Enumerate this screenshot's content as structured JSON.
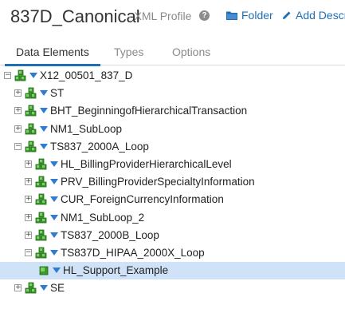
{
  "header": {
    "title": "837D_Canonical",
    "subtitle": "- XML Profile",
    "help_icon": "?",
    "folder_label": "Folder",
    "add_label": "Add Descri"
  },
  "tabs": [
    {
      "label": "Data Elements",
      "active": true
    },
    {
      "label": "Types",
      "active": false
    },
    {
      "label": "Options",
      "active": false
    }
  ],
  "tree": [
    {
      "label": "X12_00501_837_D",
      "depth": 0,
      "expander": "⊟",
      "icon": "multi-element-icon"
    },
    {
      "label": "ST",
      "depth": 1,
      "expander": "⊞",
      "icon": "multi-element-icon"
    },
    {
      "label": "BHT_BeginningofHierarchicalTransaction",
      "depth": 1,
      "expander": "⊞",
      "icon": "multi-element-icon"
    },
    {
      "label": "NM1_SubLoop",
      "depth": 1,
      "expander": "⊞",
      "icon": "multi-element-icon"
    },
    {
      "label": "TS837_2000A_Loop",
      "depth": 1,
      "expander": "⊟",
      "icon": "multi-element-icon"
    },
    {
      "label": "HL_BillingProviderHierarchicalLevel",
      "depth": 2,
      "expander": "⊞",
      "icon": "multi-element-icon"
    },
    {
      "label": "PRV_BillingProviderSpecialtyInformation",
      "depth": 2,
      "expander": "⊞",
      "icon": "multi-element-icon"
    },
    {
      "label": "CUR_ForeignCurrencyInformation",
      "depth": 2,
      "expander": "⊞",
      "icon": "multi-element-icon"
    },
    {
      "label": "NM1_SubLoop_2",
      "depth": 2,
      "expander": "⊞",
      "icon": "multi-element-icon"
    },
    {
      "label": "TS837_2000B_Loop",
      "depth": 2,
      "expander": "⊞",
      "icon": "multi-element-icon"
    },
    {
      "label": "TS837D_HIPAA_2000X_Loop",
      "depth": 2,
      "expander": "⊟",
      "icon": "multi-element-icon"
    },
    {
      "label": "HL_Support_Example",
      "depth": 3,
      "expander": "",
      "icon": "element-icon",
      "selected": true
    },
    {
      "label": "SE",
      "depth": 1,
      "expander": "⊞",
      "icon": "multi-element-icon"
    }
  ],
  "colors": {
    "accent": "#1f6fb5",
    "caret": "#2f7bd1",
    "selected": "#cfe2f7",
    "node_green": "#3a9a2a"
  }
}
